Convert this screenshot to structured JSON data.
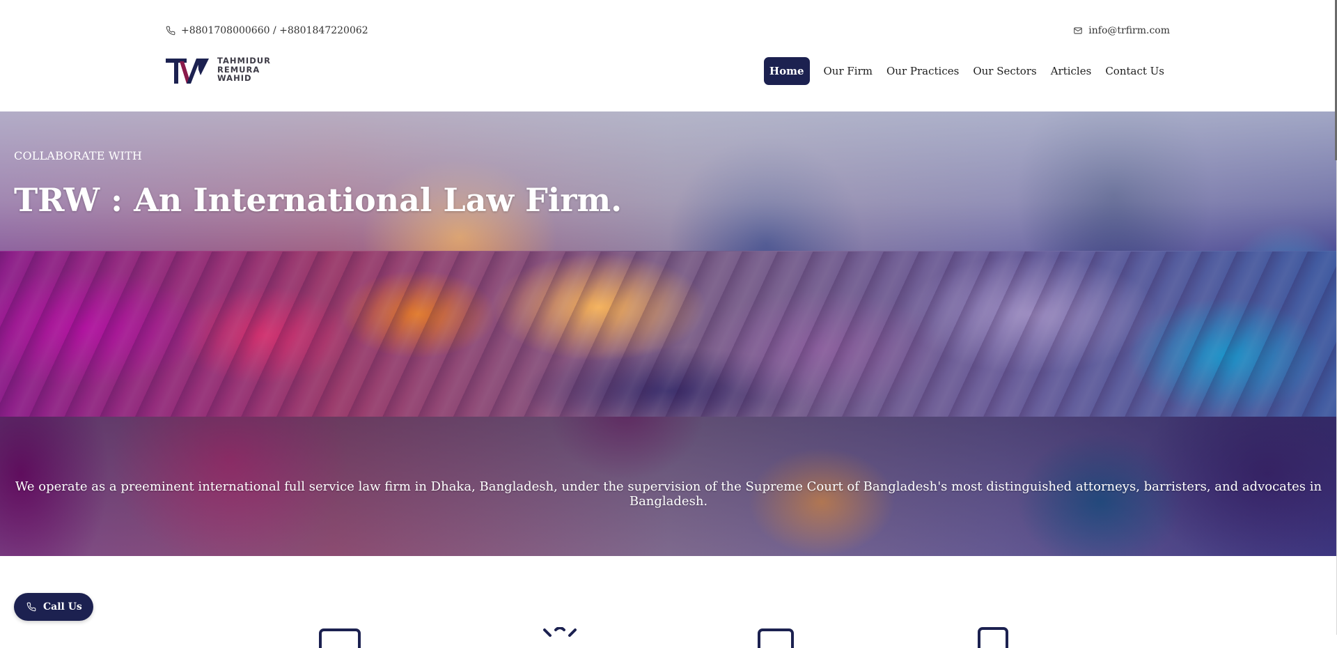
{
  "header": {
    "phone": "+8801708000660 / +8801847220062",
    "email": "info@trfirm.com",
    "logo": {
      "lines": [
        "TAHMIDUR",
        "REMURA",
        "WAHID"
      ],
      "mark_color": "#1c2150",
      "accent_color": "#8a1a4a"
    },
    "nav": [
      {
        "label": "Home",
        "active": true
      },
      {
        "label": "Our Firm",
        "active": false
      },
      {
        "label": "Our Practices",
        "active": false
      },
      {
        "label": "Our Sectors",
        "active": false
      },
      {
        "label": "Articles",
        "active": false
      },
      {
        "label": "Contact Us",
        "active": false
      }
    ]
  },
  "hero": {
    "eyebrow": "COLLABORATE WITH",
    "title": "TRW : An International Law Firm.",
    "description": "We operate as a preeminent international full service law firm in Dhaka, Bangladesh, under the supervision of the Supreme Court of Bangladesh's most distinguished attorneys, barristers, and advocates in Bangladesh."
  },
  "call_button": {
    "label": "Call Us",
    "icon": "phone-icon"
  },
  "icons": {
    "phone": "phone-icon",
    "email": "mail-icon"
  },
  "colors": {
    "primary": "#1c2150",
    "text": "#1d1d1d",
    "white": "#ffffff"
  }
}
